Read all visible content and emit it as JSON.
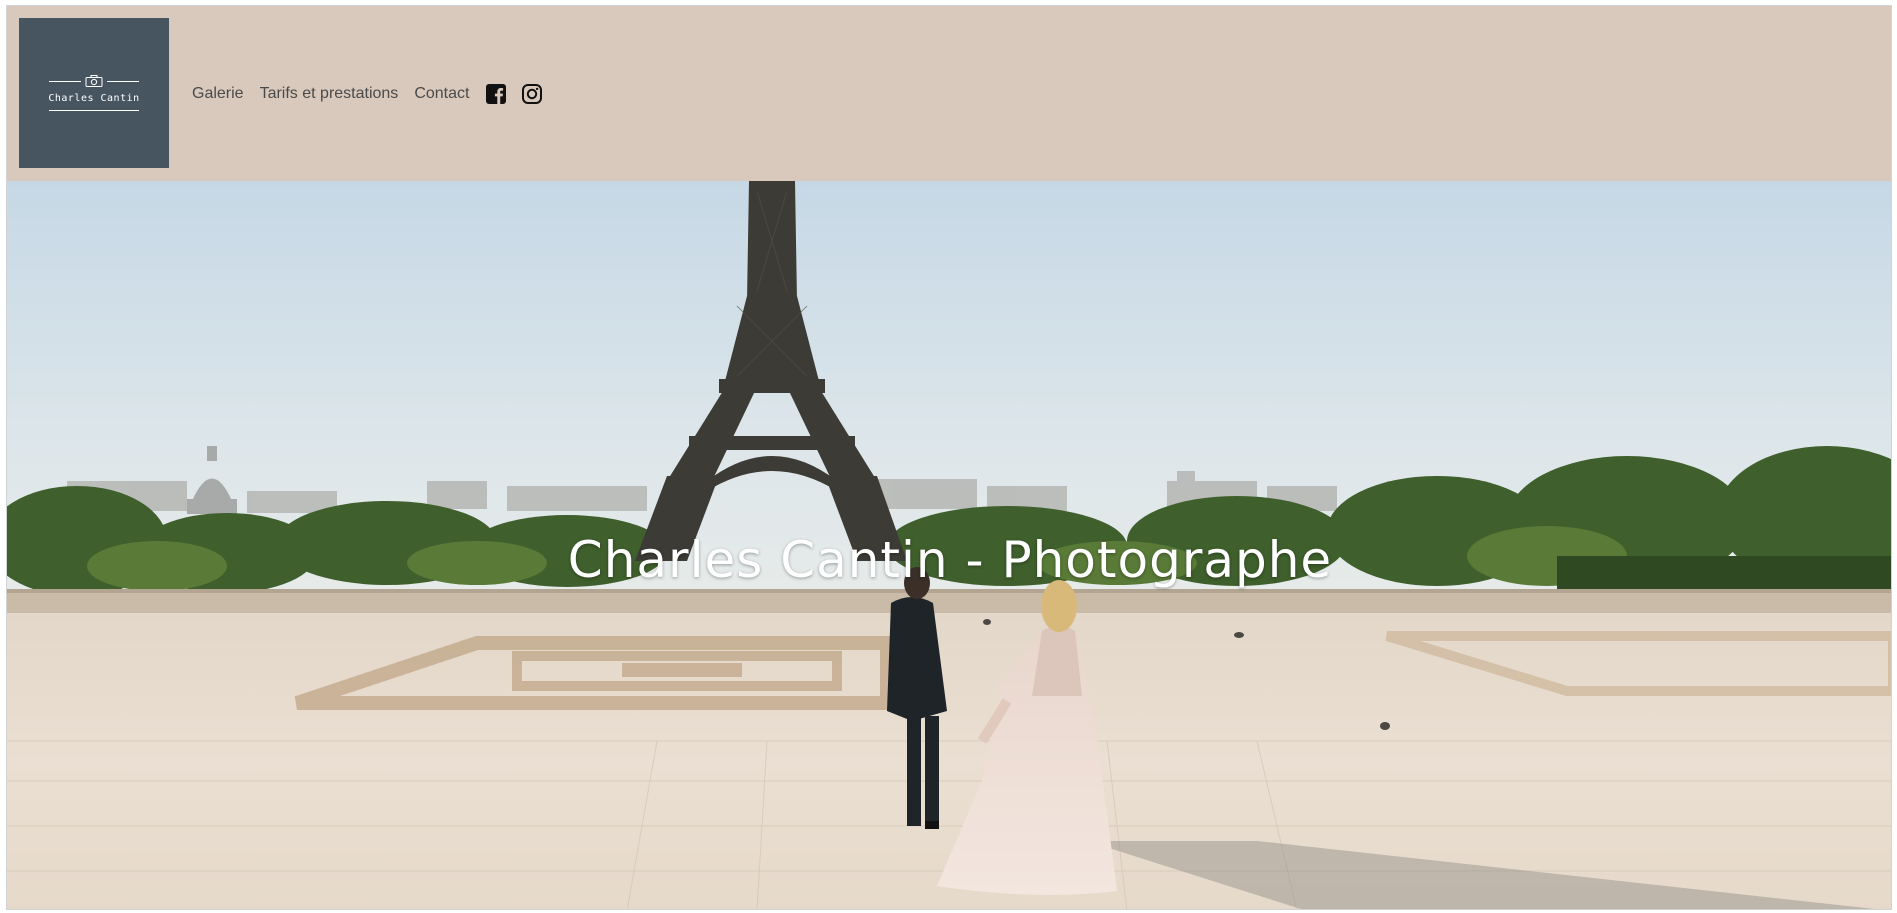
{
  "brand": {
    "logo_text": "Charles Cantin",
    "logo_icon": "camera-icon"
  },
  "nav": {
    "items": [
      {
        "label": "Galerie"
      },
      {
        "label": "Tarifs et prestations"
      },
      {
        "label": "Contact"
      }
    ],
    "social": [
      {
        "icon": "facebook-icon"
      },
      {
        "icon": "instagram-icon"
      }
    ]
  },
  "hero": {
    "title": "Charles Cantin - Photographe"
  },
  "colors": {
    "header_bg": "#d9c9bd",
    "logo_bg": "#475561",
    "nav_text": "#4a4a4a",
    "hero_title": "#ffffff"
  }
}
